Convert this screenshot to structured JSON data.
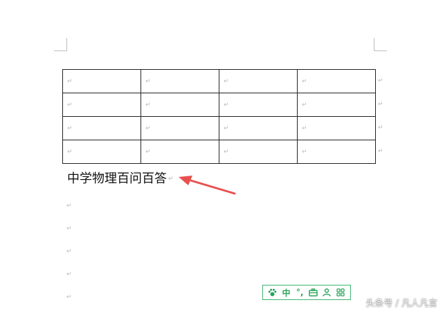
{
  "document": {
    "paragraph_mark": "↵",
    "table": {
      "rows": 4,
      "cols": 4
    },
    "heading_text": "中学物理百问百答",
    "empty_paragraph_count": 5
  },
  "ime_toolbar": {
    "items": [
      {
        "name": "paw-icon",
        "label": ""
      },
      {
        "name": "language-mode",
        "label": "中"
      },
      {
        "name": "punctuation-mode",
        "label": "°,"
      },
      {
        "name": "toolbox-icon",
        "label": ""
      },
      {
        "name": "user-icon",
        "label": ""
      },
      {
        "name": "grid-icon",
        "label": ""
      }
    ],
    "accent_color": "#2aa55a"
  },
  "watermark": {
    "text": "头条号 / 凡人凡言"
  },
  "colors": {
    "arrow": "#e8504f",
    "table_border": "#222222",
    "paragraph_mark": "#b8b8b8"
  }
}
